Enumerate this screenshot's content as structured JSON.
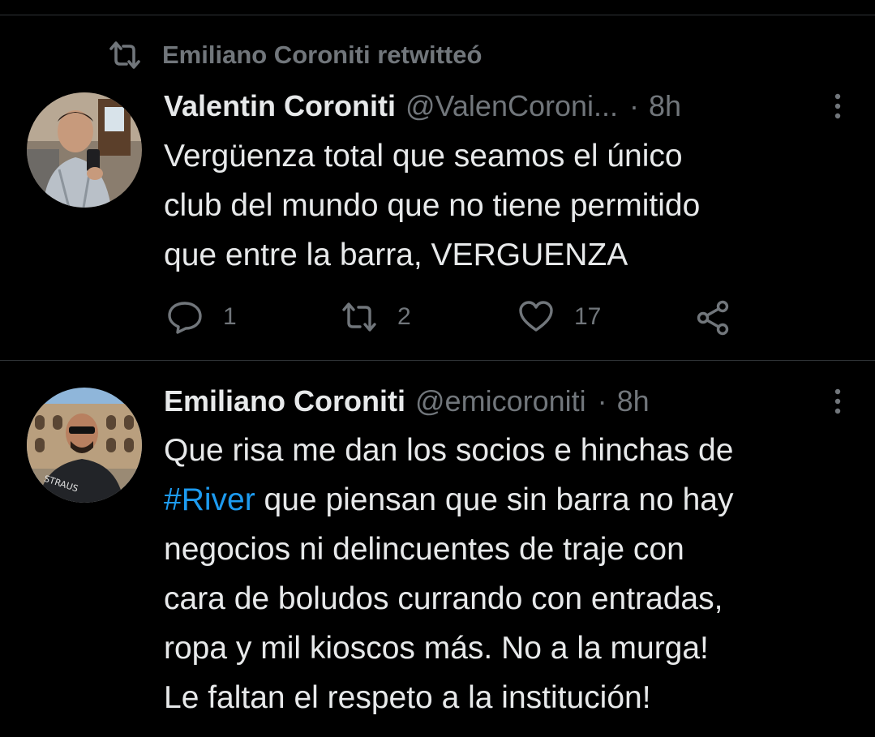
{
  "colors": {
    "background": "#000000",
    "primary_text": "#e7e9ea",
    "secondary_text": "#71767b",
    "link": "#1d9bf0",
    "divider": "#2f3336"
  },
  "retweet_context": {
    "icon": "retweet-icon",
    "text": "Emiliano Coroniti retwitteó"
  },
  "tweets": [
    {
      "avatar": "avatar-photo",
      "display_name": "Valentin Coroniti",
      "handle": "@ValenCoroni...",
      "separator": "·",
      "time": "8h",
      "more_icon": "more-vertical-icon",
      "text_lines": [
        "Vergüenza total que seamos el único",
        "club del mundo que no tiene permitido",
        "que entre la barra, VERGUENZA"
      ],
      "actions": {
        "reply": {
          "icon": "reply-icon",
          "count": "1"
        },
        "retweet": {
          "icon": "retweet-icon",
          "count": "2"
        },
        "like": {
          "icon": "heart-icon",
          "count": "17"
        },
        "share": {
          "icon": "share-icon"
        }
      }
    },
    {
      "avatar": "avatar-photo",
      "display_name": "Emiliano Coroniti",
      "handle": "@emicoroniti",
      "separator": "·",
      "time": "8h",
      "more_icon": "more-vertical-icon",
      "text_lines": {
        "line1": "Que risa me dan los socios e hinchas de",
        "line2_hashtag": "#River",
        "line2_rest": " que piensan que sin barra no hay",
        "line3": "negocios ni delincuentes de traje con",
        "line4": "cara de boludos currando con entradas,",
        "line5": "ropa y mil kioscos más. No a la murga!",
        "line6": "Le faltan el respeto a la institución!"
      }
    }
  ]
}
